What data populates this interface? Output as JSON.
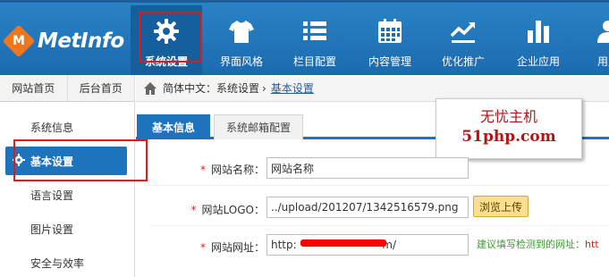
{
  "brand": {
    "name": "MetInfo",
    "mark": "M"
  },
  "nav": {
    "items": [
      {
        "label": "系统设置",
        "icon": "gear-icon"
      },
      {
        "label": "界面风格",
        "icon": "shirt-icon"
      },
      {
        "label": "栏目配置",
        "icon": "list-icon"
      },
      {
        "label": "内容管理",
        "icon": "calendar-icon"
      },
      {
        "label": "优化推广",
        "icon": "trend-icon"
      },
      {
        "label": "企业应用",
        "icon": "bar-chart-icon"
      },
      {
        "label": "用户",
        "icon": "user-icon"
      }
    ],
    "active_index": 0
  },
  "sidebar": {
    "tabs": [
      "网站首页",
      "后台首页"
    ],
    "items": [
      "系统信息",
      "基本设置",
      "语言设置",
      "图片设置",
      "安全与效率"
    ],
    "active_index": 1
  },
  "breadcrumb": {
    "root": "简体中文：系统设置",
    "sep": "›",
    "current": "基本设置"
  },
  "tabs": {
    "active": "基本信息",
    "inactive": "系统邮箱配置"
  },
  "watermark": {
    "line1": "无忧主机",
    "line2": "51php.com"
  },
  "form": {
    "site_name": {
      "label": "网站名称：",
      "value": "网站名称"
    },
    "site_logo": {
      "label": "网站LOGO：",
      "value": "../upload/201207/1342516579.png",
      "button": "浏览上传"
    },
    "site_url": {
      "label": "网站网址：",
      "value_prefix": "http:",
      "value_suffix": "m/",
      "hint": "建议填写检测到的网址：",
      "hint_tail": "htt"
    },
    "required_mark": "*"
  },
  "colors": {
    "topbar": "#1f74b9",
    "accent": "#1e73bd",
    "highlight": "#e41a1a",
    "watermark": "#b01515"
  }
}
